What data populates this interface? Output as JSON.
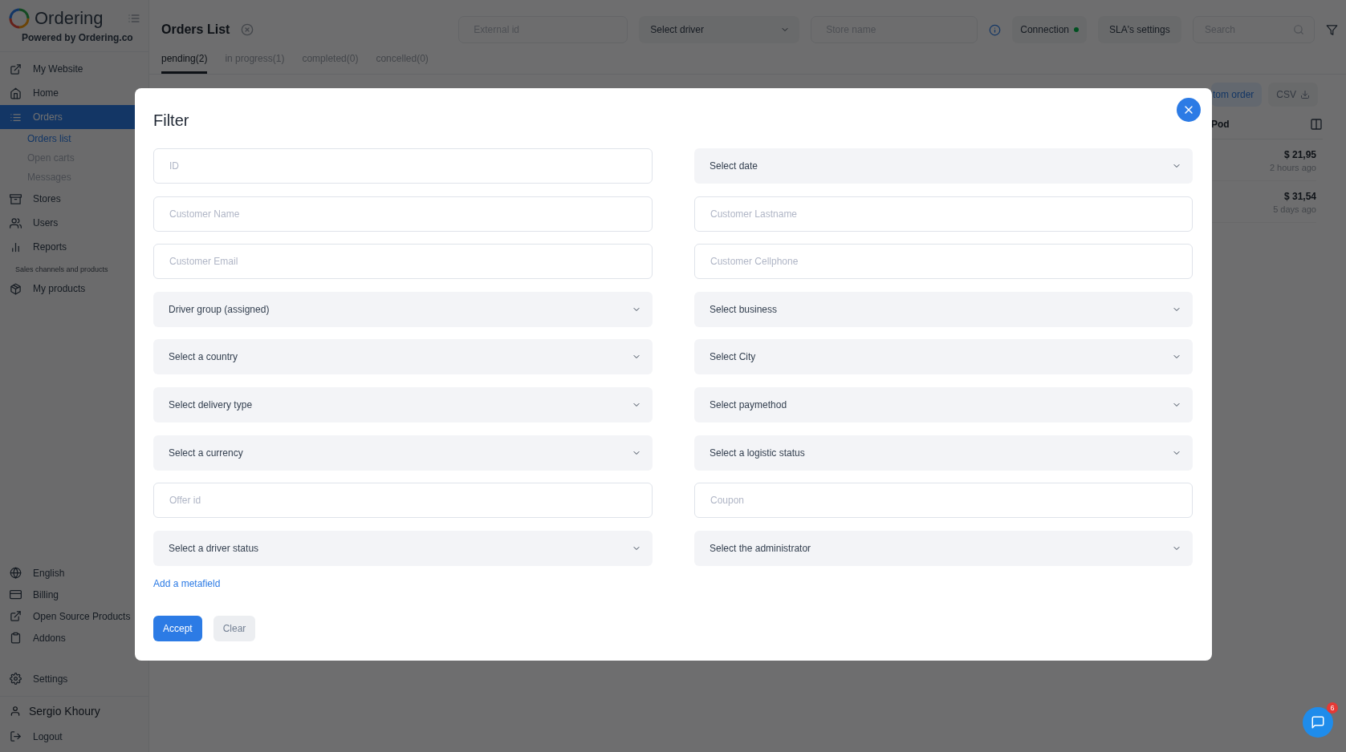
{
  "sidebar": {
    "brand": "Ordering",
    "tagline": "Powered by Ordering.co",
    "items": [
      {
        "label": "My Website",
        "selected": false
      },
      {
        "label": "Home",
        "selected": false
      },
      {
        "label": "Orders",
        "selected": true,
        "children": [
          {
            "label": "Orders list",
            "selected": true
          },
          {
            "label": "Open carts",
            "selected": false
          },
          {
            "label": "Messages",
            "selected": false
          }
        ]
      },
      {
        "label": "Stores",
        "selected": false
      },
      {
        "label": "Users",
        "selected": false
      },
      {
        "label": "Reports",
        "selected": false
      }
    ],
    "section": {
      "label": "Sales channels and products",
      "items": [
        {
          "label": "My products",
          "selected": false
        }
      ]
    },
    "footer_items": [
      {
        "label": "English",
        "selected": false
      },
      {
        "label": "Billing",
        "selected": false
      },
      {
        "label": "Open Source Products",
        "selected": false
      },
      {
        "label": "Addons",
        "selected": false
      }
    ],
    "settings": "Settings",
    "user": "Sergio Khoury",
    "logout": "Logout"
  },
  "header": {
    "title": "Orders List",
    "external_id": {
      "placeholder": "External id"
    },
    "driver_select": "Select driver",
    "store_name": {
      "placeholder": "Store name"
    },
    "connection": {
      "label": "Connection",
      "online": true
    },
    "sla": "SLA's settings",
    "search": {
      "placeholder": "Search"
    }
  },
  "tabs": [
    {
      "label": "pending(2)",
      "selected": true
    },
    {
      "label": "in progress(1)",
      "selected": false
    },
    {
      "label": "completed(0)",
      "selected": false
    },
    {
      "label": "concelled(0)",
      "selected": false
    }
  ],
  "toolbar": [
    {
      "label": "tom order",
      "kind": "accent"
    },
    {
      "label": "CSV",
      "kind": "download"
    }
  ],
  "table": {
    "column": "Pod",
    "rows": [
      {
        "total": "$ 21,95",
        "time": "2 hours ago"
      },
      {
        "total": "$ 31,54",
        "time": "5 days ago"
      }
    ]
  },
  "filter": {
    "title": "Filter",
    "fields": [
      {
        "kind": "input",
        "placeholder": "ID"
      },
      {
        "kind": "select",
        "label": "Select date"
      },
      {
        "kind": "input",
        "placeholder": "Customer Name"
      },
      {
        "kind": "input",
        "placeholder": "Customer Lastname"
      },
      {
        "kind": "input",
        "placeholder": "Customer Email"
      },
      {
        "kind": "input",
        "placeholder": "Customer Cellphone"
      },
      {
        "kind": "select",
        "label": "Driver group (assigned)"
      },
      {
        "kind": "select",
        "label": "Select business"
      },
      {
        "kind": "select",
        "label": "Select a country"
      },
      {
        "kind": "select",
        "label": "Select City"
      },
      {
        "kind": "select",
        "label": "Select delivery type"
      },
      {
        "kind": "select",
        "label": "Select paymethod"
      },
      {
        "kind": "select",
        "label": "Select a currency"
      },
      {
        "kind": "select",
        "label": "Select a logistic status"
      },
      {
        "kind": "input",
        "placeholder": "Offer id"
      },
      {
        "kind": "input",
        "placeholder": "Coupon"
      },
      {
        "kind": "select",
        "label": "Select a driver status"
      },
      {
        "kind": "select",
        "label": "Select the administrator"
      }
    ],
    "link": "Add a metafield",
    "buttons": [
      {
        "label": "Accept",
        "kind": "primary"
      },
      {
        "label": "Clear",
        "kind": "secondary"
      }
    ]
  },
  "chat": {
    "badge": "6"
  }
}
